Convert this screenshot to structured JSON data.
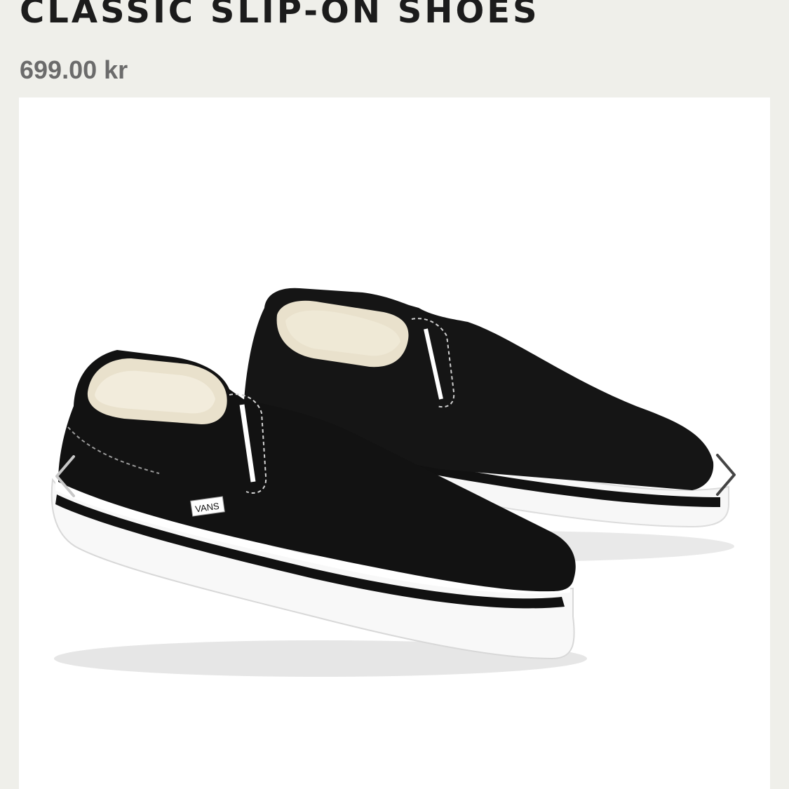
{
  "product": {
    "title": "CLASSIC SLIP-ON SHOES",
    "price": "699.00 kr",
    "brand_tag": "VANS"
  },
  "gallery": {
    "icons": {
      "previous": "chevron-left-icon",
      "next": "chevron-right-icon"
    },
    "colors": {
      "background": "#ffffff",
      "canvas": "#black",
      "sole": "#ffffff",
      "foxing_stripe": "#111111",
      "lining": "#e9e1cc"
    }
  },
  "page": {
    "background_color": "#efefea"
  }
}
